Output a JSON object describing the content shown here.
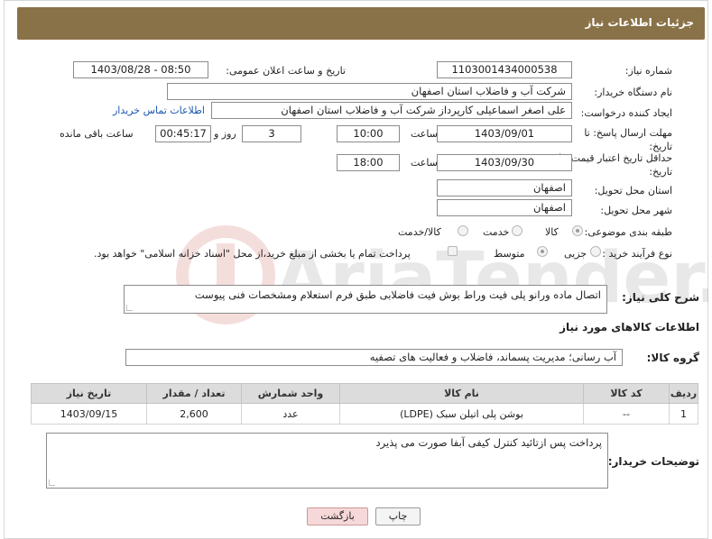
{
  "header": {
    "title": "جزئیات اطلاعات نیاز"
  },
  "form": {
    "need_number_label": "شماره نیاز:",
    "need_number": "1103001434000538",
    "announce_label": "تاریخ و ساعت اعلان عمومی:",
    "announce_value": "1403/08/28 - 08:50",
    "buyer_org_label": "نام دستگاه خریدار:",
    "buyer_org": "شرکت آب و فاضلاب استان اصفهان",
    "creator_label": "ایجاد کننده درخواست:",
    "creator": "علی اصغر اسماعیلی کارپرداز شرکت آب و فاضلاب استان اصفهان",
    "contact_link": "اطلاعات تماس خریدار",
    "reply_deadline_label": "مهلت ارسال پاسخ: تا تاریخ:",
    "reply_date": "1403/09/01",
    "time_label": "ساعت",
    "reply_time": "10:00",
    "days": "3",
    "days_label": "روز و",
    "remaining": "00:45:17",
    "remaining_label": "ساعت باقی مانده",
    "price_validity_label": "حداقل تاریخ اعتبار قیمت: تا تاریخ:",
    "price_date": "1403/09/30",
    "price_time_label": "ساعت",
    "price_time": "18:00",
    "province_label": "استان محل تحویل:",
    "province": "اصفهان",
    "city_label": "شهر محل تحویل:",
    "city": "اصفهان",
    "category_label": "طبقه بندی موضوعی:",
    "category_options": [
      "کالا",
      "خدمت",
      "کالا/خدمت"
    ],
    "purchase_type_label": "نوع فرآیند خرید :",
    "purchase_options": [
      "جزیی",
      "متوسط"
    ],
    "payment_note": "پرداخت تمام یا بخشی از مبلغ خرید،از محل \"اسناد خزانه اسلامی\" خواهد بود."
  },
  "description": {
    "label": "شرح کلی نیاز:",
    "text": "اتصال ماده ورانو پلی فیت وراط بوش فیت فاضلابی طبق فرم استعلام ومشخصات فنی پیوست"
  },
  "goods_section": {
    "title": "اطلاعات کالاهای مورد نیاز"
  },
  "goods_group": {
    "label": "گروه کالا:",
    "value": "آب رسانی؛ مدیریت پسماند، فاضلاب و فعالیت های تصفیه"
  },
  "table": {
    "headers": [
      "ردیف",
      "کد کالا",
      "نام کالا",
      "واحد شمارش",
      "تعداد / مقدار",
      "تاریخ نیاز"
    ],
    "rows": [
      [
        "1",
        "--",
        "بوشن پلی اتیلن سبک (LDPE)",
        "عدد",
        "2,600",
        "1403/09/15"
      ]
    ]
  },
  "buyer_notes": {
    "label": "توضیحات خریدار:",
    "text": "پرداخت پس ازتائید کنترل کیفی آبفا صورت می پذیرد"
  },
  "buttons": {
    "print": "چاپ",
    "back": "بازگشت"
  },
  "watermark": {
    "text": "AriaTender.neT"
  },
  "colors": {
    "header": "#8a7248",
    "link": "#1b56b0",
    "back_button": "#f7d8d8"
  }
}
